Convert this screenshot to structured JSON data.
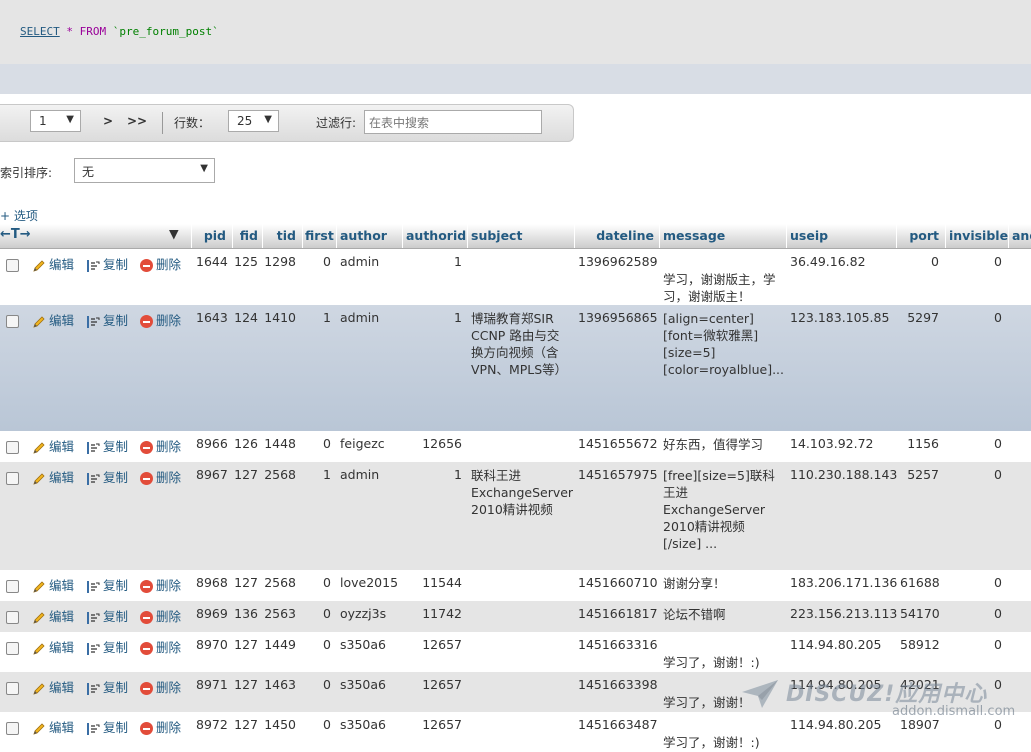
{
  "query": {
    "select": "SELECT",
    "star_from": " * FROM ",
    "table": "`pre_forum_post`"
  },
  "nav": {
    "page": "1",
    "next": ">",
    "last": ">>",
    "rows_label": "行数：",
    "rows_value": "25",
    "filter_label": "过滤行:",
    "filter_placeholder": "在表中搜索"
  },
  "sort": {
    "label": "按索引排序:",
    "value": "无"
  },
  "options_label": "+ 选项",
  "arrows_label": "←T→",
  "columns": [
    "pid",
    "fid",
    "tid",
    "first",
    "author",
    "authorid",
    "subject",
    "dateline",
    "message",
    "useip",
    "port",
    "invisible",
    "anon"
  ],
  "actions": {
    "edit": "编辑",
    "copy": "复制",
    "delete": "删除"
  },
  "rows": [
    {
      "pid": "1644",
      "fid": "125",
      "tid": "1298",
      "first": "0",
      "author": "admin",
      "authorid": "1",
      "subject": "",
      "dateline": "1396962589",
      "message": "学习，谢谢版主，学习，谢谢版主！",
      "useip": "36.49.16.82",
      "port": "0",
      "invisible": "0"
    },
    {
      "pid": "1643",
      "fid": "124",
      "tid": "1410",
      "first": "1",
      "author": "admin",
      "authorid": "1",
      "subject": "博瑞教育郑SIR CCNP 路由与交换方向视频（含VPN、MPLS等）",
      "dateline": "1396956865",
      "message": "[align=center][font=微软雅黑][size=5][color=royalblue]...",
      "useip": "123.183.105.85",
      "port": "5297",
      "invisible": "0"
    },
    {
      "pid": "8966",
      "fid": "126",
      "tid": "1448",
      "first": "0",
      "author": "feigezc",
      "authorid": "12656",
      "subject": "",
      "dateline": "1451655672",
      "message": "好东西，值得学习",
      "useip": "14.103.92.72",
      "port": "1156",
      "invisible": "0"
    },
    {
      "pid": "8967",
      "fid": "127",
      "tid": "2568",
      "first": "1",
      "author": "admin",
      "authorid": "1",
      "subject": "联科王进 ExchangeServer 2010精讲视频",
      "dateline": "1451657975",
      "message": "[free][size=5]联科王进 ExchangeServer 2010精讲视频 [/size] ...",
      "useip": "110.230.188.143",
      "port": "5257",
      "invisible": "0"
    },
    {
      "pid": "8968",
      "fid": "127",
      "tid": "2568",
      "first": "0",
      "author": "love2015",
      "authorid": "11544",
      "subject": "",
      "dateline": "1451660710",
      "message": "谢谢分享！",
      "useip": "183.206.171.136",
      "port": "61688",
      "invisible": "0"
    },
    {
      "pid": "8969",
      "fid": "136",
      "tid": "2563",
      "first": "0",
      "author": "oyzzj3s",
      "authorid": "11742",
      "subject": "",
      "dateline": "1451661817",
      "message": "论坛不错啊",
      "useip": "223.156.213.113",
      "port": "54170",
      "invisible": "0"
    },
    {
      "pid": "8970",
      "fid": "127",
      "tid": "1449",
      "first": "0",
      "author": "s350a6",
      "authorid": "12657",
      "subject": "",
      "dateline": "1451663316",
      "message": "学习了，谢谢！:)",
      "useip": "114.94.80.205",
      "port": "58912",
      "invisible": "0"
    },
    {
      "pid": "8971",
      "fid": "127",
      "tid": "1463",
      "first": "0",
      "author": "s350a6",
      "authorid": "12657",
      "subject": "",
      "dateline": "1451663398",
      "message": "学习了，谢谢！",
      "useip": "114.94.80.205",
      "port": "42021",
      "invisible": "0"
    },
    {
      "pid": "8972",
      "fid": "127",
      "tid": "1450",
      "first": "0",
      "author": "s350a6",
      "authorid": "12657",
      "subject": "",
      "dateline": "1451663487",
      "message": "学习了，谢谢！:)",
      "useip": "114.94.80.205",
      "port": "18907",
      "invisible": "0"
    }
  ],
  "watermark": {
    "brand": "DISCUZ!应用中心",
    "url": "addon.dismall.com"
  }
}
